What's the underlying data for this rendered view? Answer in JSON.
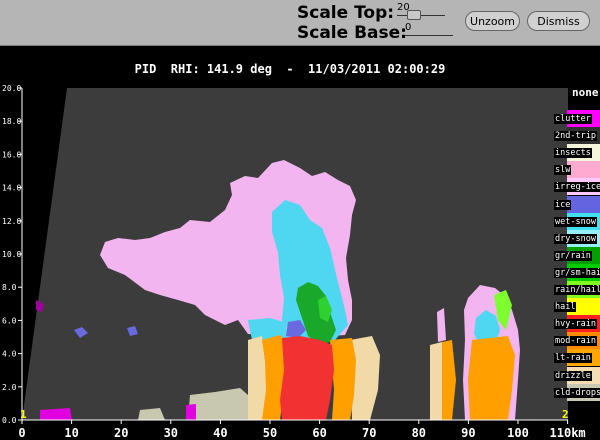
{
  "controls": {
    "scale_top_label": "Scale Top:",
    "scale_top_value": "20",
    "scale_base_label": "Scale Base:",
    "scale_base_value": "0",
    "unzoom_label": "Unzoom",
    "dismiss_label": "Dismiss"
  },
  "plot": {
    "title": "PID  RHI: 141.9 deg  -  11/03/2011 02:00:29",
    "x_unit": "km",
    "x_ticks": [
      "0",
      "10",
      "20",
      "30",
      "40",
      "50",
      "60",
      "70",
      "80",
      "90",
      "100",
      "110"
    ],
    "y_ticks": [
      "0.0",
      "2.0",
      "4.0",
      "6.0",
      "8.0",
      "10.0",
      "12.0",
      "14.0",
      "16.0",
      "18.0",
      "20.0"
    ],
    "corner_left": "1",
    "corner_right": "2"
  },
  "legend": {
    "header": "none",
    "items": [
      {
        "label": "clutter",
        "color": "#ff00ff"
      },
      {
        "label": "2nd-trip",
        "color": "#303030"
      },
      {
        "label": "insects",
        "color": "#f5f5dc"
      },
      {
        "label": "slw",
        "color": "#ffaad0"
      },
      {
        "label": "irreg-ice",
        "color": "#ffc8ff"
      },
      {
        "label": "ice",
        "color": "#6464e0"
      },
      {
        "label": "wet-snow",
        "color": "#40e0f0"
      },
      {
        "label": "dry-snow",
        "color": "#96f0ff"
      },
      {
        "label": "gr/rain",
        "color": "#00a000"
      },
      {
        "label": "gr/sm-hail",
        "color": "#00cc00"
      },
      {
        "label": "rain/hail",
        "color": "#80ff20"
      },
      {
        "label": "hail",
        "color": "#ffff00"
      },
      {
        "label": "hvy-rain",
        "color": "#ff2020"
      },
      {
        "label": "mod-rain",
        "color": "#ff8c00"
      },
      {
        "label": "lt-rain",
        "color": "#ffa500"
      },
      {
        "label": "drizzle",
        "color": "#f5deb3"
      },
      {
        "label": "cld-drops",
        "color": "#c8c8b0"
      }
    ]
  }
}
